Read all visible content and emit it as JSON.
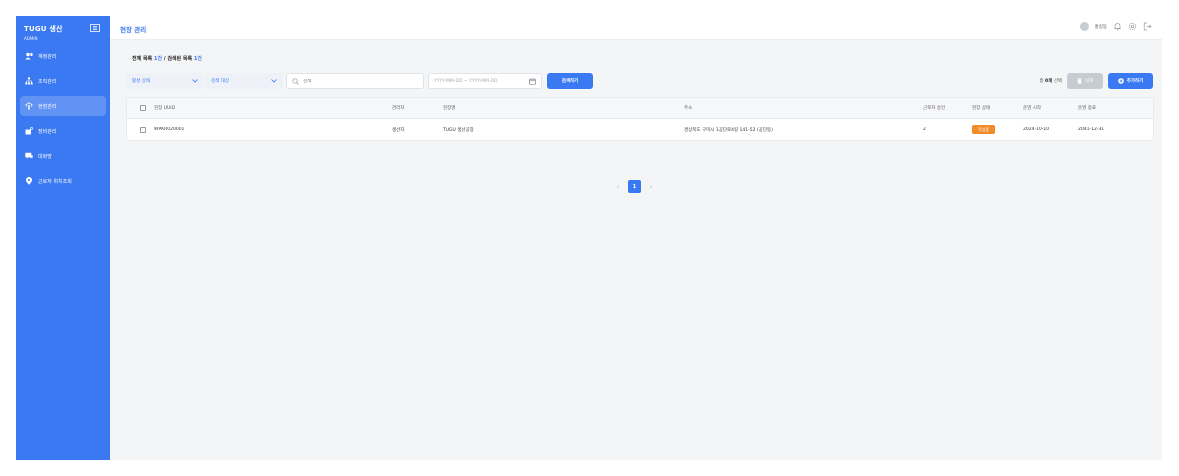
{
  "brand": {
    "title": "TUGU 생산",
    "role": "ADMIN"
  },
  "sidebar": {
    "items": [
      {
        "label": "계정관리",
        "icon": "user-manage-icon"
      },
      {
        "label": "조직관리",
        "icon": "org-tree-icon"
      },
      {
        "label": "현장관리",
        "icon": "site-icon",
        "active": true
      },
      {
        "label": "장비관리",
        "icon": "equipment-icon"
      },
      {
        "label": "대화방",
        "icon": "chat-icon"
      },
      {
        "label": "근로자 위치조회",
        "icon": "location-pin-icon"
      }
    ]
  },
  "header": {
    "title": "현장 관리",
    "username": "홍길동"
  },
  "summary": {
    "total_label": "전체 목록",
    "total_count": "1건",
    "separator": "/",
    "filtered_label": "검색된 목록",
    "filtered_count": "1건"
  },
  "filters": {
    "status_select": "활성 상태",
    "target_select": "검색 대상",
    "search_placeholder": "검색",
    "date_placeholder": "YYYY-MM-DD ~ YYYY-MM-DD",
    "search_button": "검색하기"
  },
  "actions": {
    "selected_prefix": "총",
    "selected_count": "0개",
    "selected_suffix": "선택",
    "delete_label": "삭제",
    "add_label": "추가하기"
  },
  "table": {
    "headers": [
      "현장 UUID",
      "관리자",
      "현장명",
      "주소",
      "근로자 승인",
      "현장 상태",
      "운영 시작",
      "운영 종료"
    ],
    "rows": [
      {
        "uuid": "WPKR020001",
        "manager": "생산자",
        "name": "TUGU 생산공장",
        "address": "경상북도 구미시 1공단로4길 141-52 (공단동)",
        "approval": "2",
        "status": "작업중",
        "start": "2024-10-10",
        "end": "2041-12-31"
      }
    ]
  },
  "pagination": {
    "current": "1",
    "prev": "‹",
    "next": "›"
  },
  "colors": {
    "accent": "#3a79f2",
    "status_active": "#f28c28",
    "sidebar_bg": "#3a79f2"
  }
}
